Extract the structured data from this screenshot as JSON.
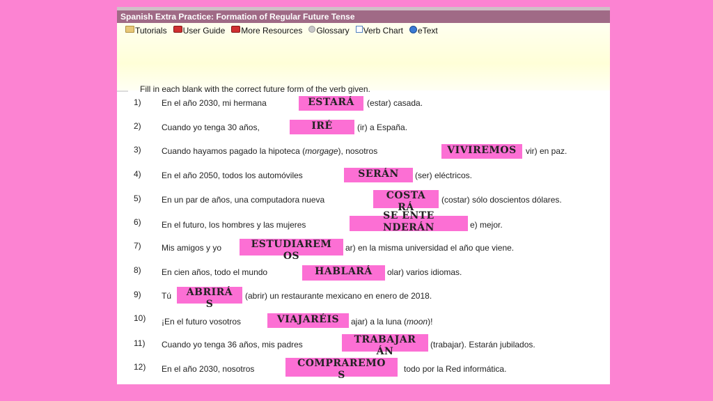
{
  "window": {
    "title": "Spanish Extra Practice: Formation of Regular Future Tense"
  },
  "menu": [
    {
      "label": "Tutorials",
      "icon": "folder-icon"
    },
    {
      "label": "User Guide",
      "icon": "briefcase-icon"
    },
    {
      "label": "More Resources",
      "icon": "briefcase-icon"
    },
    {
      "label": "Glossary",
      "icon": "circle-icon"
    },
    {
      "label": "Verb Chart",
      "icon": "chart-icon"
    },
    {
      "label": "eText",
      "icon": "globe-icon"
    }
  ],
  "instructions": "Fill in each blank with the correct future form of the verb given.",
  "questions": [
    {
      "num": "1)",
      "before": "En el año 2030, mi hermana",
      "after": "(estar) casada.",
      "answer": "ESTARÁ"
    },
    {
      "num": "2)",
      "before": "Cuando yo tenga 30 años,",
      "after": "(ir) a España.",
      "answer": "IRÉ"
    },
    {
      "num": "3)",
      "before": "Cuando hayamos pagado la hipoteca (",
      "italic": "morgage",
      "before2": "), nosotros",
      "after": "vir) en paz.",
      "answer": "VIVIREMOS"
    },
    {
      "num": "4)",
      "before": "En el año 2050, todos los automóviles",
      "after": "(ser) eléctricos.",
      "answer": "SERÁN"
    },
    {
      "num": "5)",
      "before": "En un par de años, una computadora nueva",
      "after": "(costar) sólo doscientos dólares.",
      "answer": "COSTARÁ"
    },
    {
      "num": "6)",
      "before": "En el futuro, los hombres y las mujeres",
      "after": "e) mejor.",
      "answer": "SE ENTENDERÁN"
    },
    {
      "num": "7)",
      "before": "Mis amigos y yo",
      "after": "ar) en la misma universidad el año que viene.",
      "answer": "ESTUDIAREMOS"
    },
    {
      "num": "8)",
      "before": "En cien años, todo el mundo",
      "after": "olar) varios idiomas.",
      "answer": "HABLARÁ"
    },
    {
      "num": "9)",
      "before": "Tú",
      "after": "(abrir) un restaurante mexicano en enero de 2018.",
      "answer": "ABRIRÁS"
    },
    {
      "num": "10)",
      "before": "¡En el futuro vosotros",
      "after": "ajar) a la luna (",
      "italic_after": "moon",
      "after2": ")!",
      "answer": "VIAJARÉIS"
    },
    {
      "num": "11)",
      "before": "Cuando yo tenga 36 años, mis padres",
      "after": "(trabajar). Estarán jubilados.",
      "answer": "TRABAJARÁN"
    },
    {
      "num": "12)",
      "before": "En el año 2030, nosotros",
      "after": "todo por la Red informática.",
      "answer": "COMPRAREMOS"
    }
  ],
  "colors": {
    "background": "#fc83d2",
    "answer_fill": "#fc6fd4",
    "title_bar": "#a06a86"
  }
}
